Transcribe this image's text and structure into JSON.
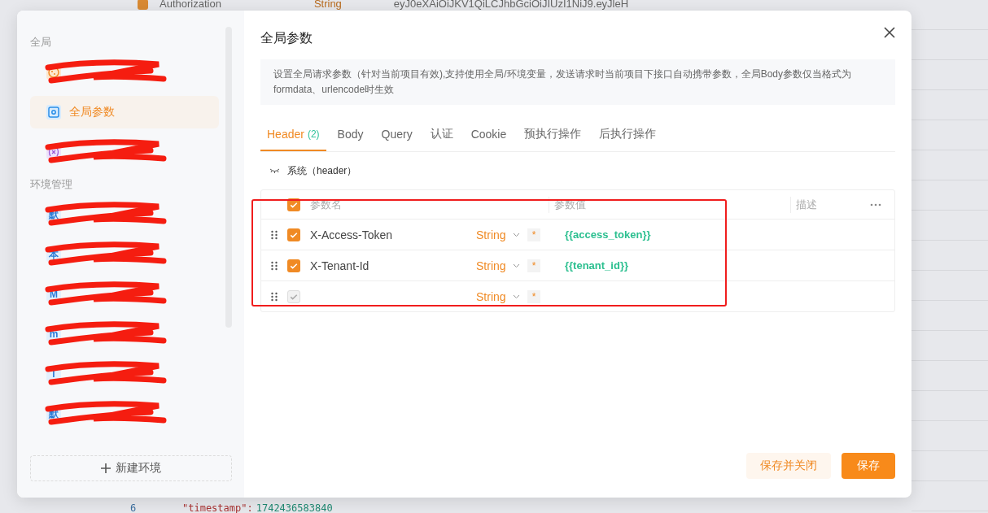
{
  "background": {
    "top_row": {
      "checked": true,
      "name": "Authorization",
      "type": "String",
      "value": "eyJ0eXAiOiJKV1QiLCJhbGciOiJIUzI1NiJ9.eyJleH"
    },
    "code_lines": [
      {
        "number": "6",
        "key": "\"timestamp\":",
        "value": "1742436583840"
      }
    ]
  },
  "sidebar": {
    "sections": [
      {
        "title": "全局",
        "items": [
          {
            "kind": "cookie",
            "selected": false,
            "redacted": true
          },
          {
            "kind": "params",
            "label": "全局参数",
            "selected": true,
            "redacted": false
          },
          {
            "kind": "variable",
            "selected": false,
            "redacted": true
          }
        ]
      },
      {
        "title": "环境管理",
        "items": [
          {
            "kind": "env",
            "badge": "默",
            "selected": false,
            "redacted": true
          },
          {
            "kind": "env",
            "badge": "本",
            "selected": false,
            "redacted": true
          },
          {
            "kind": "env",
            "badge": "M",
            "selected": false,
            "redacted": true
          },
          {
            "kind": "env",
            "badge": "m",
            "selected": false,
            "redacted": true
          },
          {
            "kind": "env",
            "badge": "l",
            "selected": false,
            "redacted": true
          },
          {
            "kind": "env",
            "badge": "默",
            "selected": false,
            "redacted": true
          }
        ]
      }
    ],
    "new_button": "新建环境"
  },
  "dialog": {
    "title": "全局参数",
    "notice": "设置全局请求参数（针对当前项目有效),支持使用全局/环境变量，发送请求时当前项目下接口自动携带参数，全局Body参数仅当格式为formdata、urlencode时生效",
    "tabs": [
      {
        "label": "Header",
        "count": "(2)",
        "selected": true
      },
      {
        "label": "Body",
        "selected": false
      },
      {
        "label": "Query",
        "selected": false
      },
      {
        "label": "认证",
        "selected": false
      },
      {
        "label": "Cookie",
        "selected": false
      },
      {
        "label": "预执行操作",
        "selected": false
      },
      {
        "label": "后执行操作",
        "selected": false
      }
    ],
    "system_section": "系统（header）",
    "table": {
      "header_checked": true,
      "columns": [
        "参数名",
        "参数值",
        "描述"
      ],
      "rows": [
        {
          "name": "X-Access-Token",
          "type": "String",
          "required_mark": "*",
          "value": "{{access_token}}",
          "checked": true,
          "disabled": false
        },
        {
          "name": "X-Tenant-Id",
          "type": "String",
          "required_mark": "*",
          "value": "{{tenant_id}}",
          "checked": true,
          "disabled": false
        },
        {
          "type": "String",
          "required_mark": "*",
          "checked": true,
          "disabled": true
        }
      ]
    },
    "buttons": [
      {
        "label": "保存并关闭",
        "kind": "secondary"
      },
      {
        "label": "保存",
        "kind": "primary"
      }
    ]
  }
}
